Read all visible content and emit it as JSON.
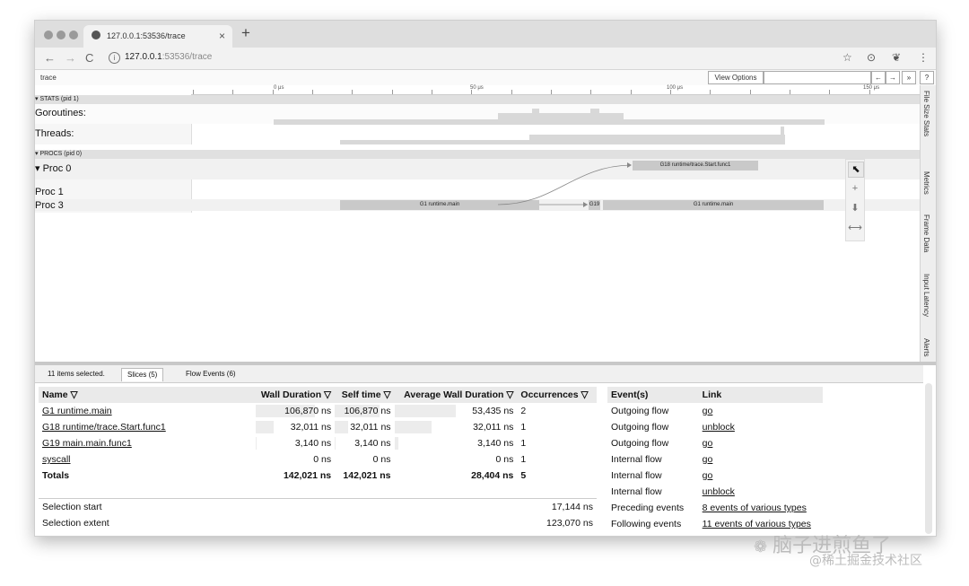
{
  "browser": {
    "tab_title": "127.0.0.1:53536/trace",
    "tab_close": "×",
    "new_tab": "+",
    "url_host": "127.0.0.1",
    "url_rest": ":53536/trace",
    "back": "←",
    "forward": "→",
    "reload": "C",
    "info": "i",
    "star": "☆",
    "ext": "⊙",
    "ext2": "❦",
    "menu": "⋮"
  },
  "trace": {
    "name": "trace",
    "view_options": "View Options",
    "prev": "←",
    "next": "→",
    "more": "»",
    "help": "?"
  },
  "ruler": [
    "0 μs",
    "50 μs",
    "100 μs",
    "150 μs"
  ],
  "stats": {
    "header": "▾ STATS (pid 1)",
    "goroutines": "Goroutines:",
    "threads": "Threads:"
  },
  "procs": {
    "header": "▾ PROCS (pid 0)",
    "proc0": "▾  Proc 0",
    "proc1": "Proc 1",
    "proc3": "Proc 3",
    "slice_g18": "G18 runtime/trace.Start.func1",
    "slice_g1a": "G1 runtime.main",
    "slice_g19": "G19",
    "slice_g1b": "G1 runtime.main"
  },
  "tools": [
    "⬉",
    "+",
    "⬇",
    "⟷"
  ],
  "side_tabs": [
    "File Size Stats",
    "Metrics",
    "Frame Data",
    "Input Latency",
    "Alerts"
  ],
  "bottom_tabs": {
    "selected_count": "11 items selected.",
    "slices": "Slices (5)",
    "flow": "Flow Events (6)"
  },
  "slices_table": {
    "headers": [
      "Name ▽",
      "Wall Duration ▽",
      "Self time ▽",
      "Average Wall Duration ▽",
      "Occurrences ▽"
    ],
    "rows": [
      {
        "name": "G1 runtime.main",
        "wall": "106,870 ns",
        "self": "106,870 ns",
        "avg": "53,435 ns",
        "occ": "2",
        "wall_frac": 0.75,
        "self_frac": 0.75,
        "avg_frac": 0.5
      },
      {
        "name": "G18 runtime/trace.Start.func1",
        "wall": "32,011 ns",
        "self": "32,011 ns",
        "avg": "32,011 ns",
        "occ": "1",
        "wall_frac": 0.23,
        "self_frac": 0.23,
        "avg_frac": 0.3
      },
      {
        "name": "G19 main.main.func1",
        "wall": "3,140 ns",
        "self": "3,140 ns",
        "avg": "3,140 ns",
        "occ": "1",
        "wall_frac": 0.02,
        "self_frac": 0.02,
        "avg_frac": 0.03
      },
      {
        "name": "syscall",
        "wall": "0 ns",
        "self": "0 ns",
        "avg": "0 ns",
        "occ": "1",
        "wall_frac": 0.0,
        "self_frac": 0.0,
        "avg_frac": 0.0
      }
    ],
    "totals": {
      "label": "Totals",
      "wall": "142,021 ns",
      "self": "142,021 ns",
      "avg": "28,404 ns",
      "occ": "5"
    }
  },
  "selection": {
    "start_label": "Selection start",
    "start_value": "17,144 ns",
    "extent_label": "Selection extent",
    "extent_value": "123,070 ns"
  },
  "flow_table": {
    "headers": [
      "Event(s)",
      "Link"
    ],
    "rows": [
      {
        "event": "Outgoing flow",
        "link": "go"
      },
      {
        "event": "Outgoing flow",
        "link": "unblock"
      },
      {
        "event": "Outgoing flow",
        "link": "go"
      },
      {
        "event": "Internal flow",
        "link": "go"
      },
      {
        "event": "Internal flow",
        "link": "go"
      },
      {
        "event": "Internal flow",
        "link": "unblock"
      },
      {
        "event": "Preceding events",
        "link": "8 events of various types"
      },
      {
        "event": "Following events",
        "link": "11 events of various types"
      }
    ]
  },
  "watermark": {
    "line1": "脑子进煎鱼了",
    "line2": "@稀土掘金技术社区"
  }
}
